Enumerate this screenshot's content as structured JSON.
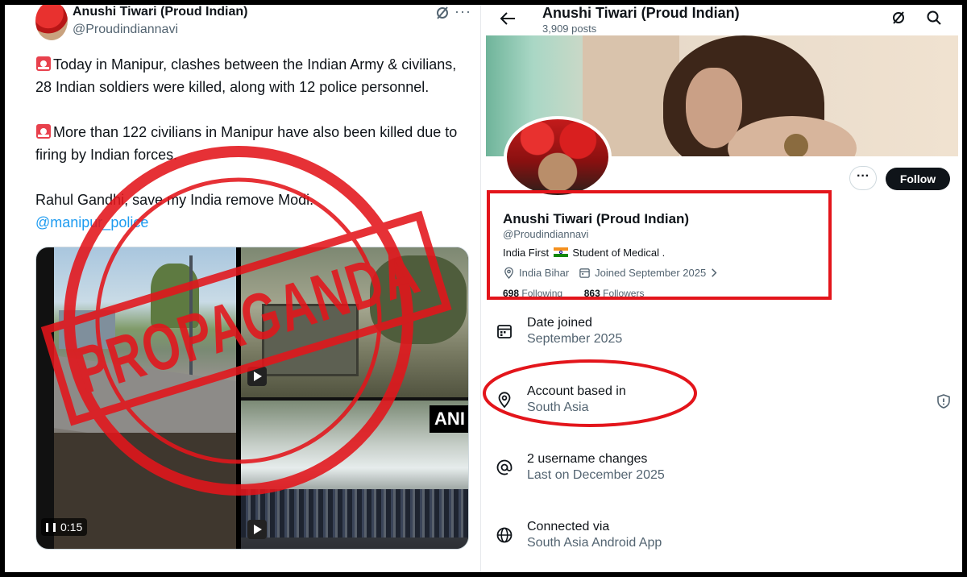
{
  "tweet": {
    "author_name": "Anushi Tiwari (Proud Indian)",
    "author_handle": "@Proudindiannavi",
    "para1": "Today in Manipur, clashes between the Indian Army & civilians, 28 Indian soldiers were killed, along with 12 police personnel.",
    "para2": "More than 122 civilians in Manipur have also been killed due to firing by Indian forces.",
    "para3": "Rahul Gandhi, save my India remove Modi.",
    "mention": "@manipur_police",
    "video_time": "0:15",
    "video_watermark": "ANI",
    "stamp_text": "PROPAGANDA",
    "icons": {
      "siren": "siren-emoji-icon",
      "grok": "grok-icon",
      "more": "more-icon"
    }
  },
  "profile": {
    "header_title": "Anushi Tiwari (Proud Indian)",
    "header_posts": "3,909 posts",
    "name": "Anushi Tiwari (Proud Indian)",
    "handle": "@Proudindiannavi",
    "bio_part1": "India First",
    "bio_part2": "Student of Medical .",
    "location": "India Bihar",
    "joined": "Joined September 2025",
    "following_count": "698",
    "following_label": "Following",
    "followers_count": "863",
    "followers_label": "Followers",
    "more_label": "···",
    "follow_label": "Follow"
  },
  "about": [
    {
      "label": "Date joined",
      "value": "September 2025",
      "icon": "calendar-icon"
    },
    {
      "label": "Account based in",
      "value": "South Asia",
      "icon": "location-pin-icon"
    },
    {
      "label": "2 username changes",
      "value": "Last on December 2025",
      "icon": "at-sign-icon"
    },
    {
      "label": "Connected via",
      "value": "South Asia Android App",
      "icon": "globe-icon"
    }
  ],
  "colors": {
    "annotation_red": "#e3151b",
    "link_blue": "#1d9bf0",
    "muted": "#536471",
    "dark": "#0f1419"
  }
}
